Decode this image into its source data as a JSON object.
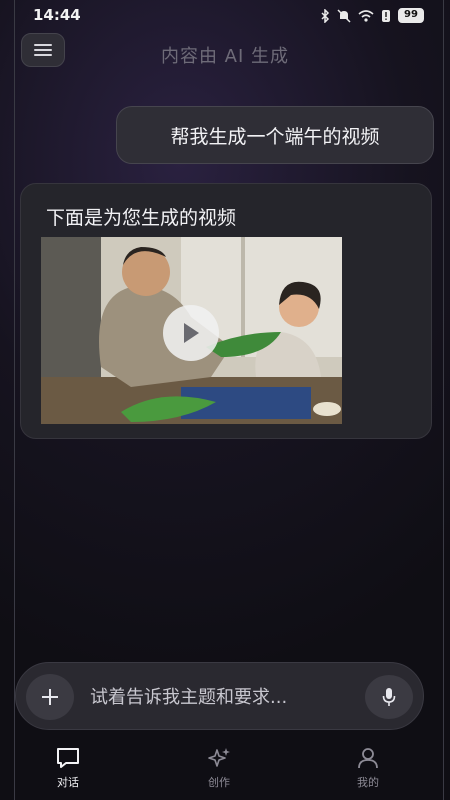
{
  "status_bar": {
    "time": "14:44",
    "battery": "99"
  },
  "header": {
    "title": "内容由 AI 生成"
  },
  "chat": {
    "user_message": "帮我生成一个端午的视频",
    "bot_message": "下面是为您生成的视频"
  },
  "input": {
    "placeholder": "试着告诉我主题和要求..."
  },
  "nav": {
    "items": [
      {
        "label": "对话",
        "icon": "chat-bubble-icon",
        "active": true
      },
      {
        "label": "创作",
        "icon": "sparkle-icon",
        "active": false
      },
      {
        "label": "我的",
        "icon": "person-icon",
        "active": false
      }
    ]
  }
}
